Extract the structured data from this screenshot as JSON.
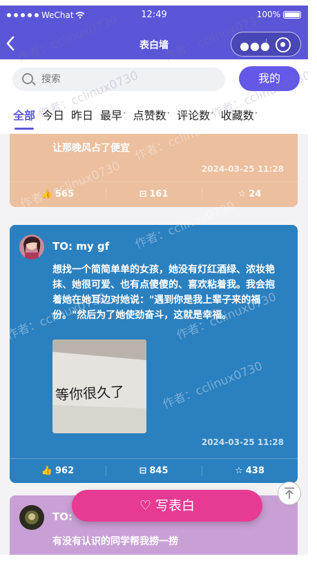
{
  "status_bar": {
    "carrier": "WeChat",
    "time": "12:49",
    "battery": "100%"
  },
  "nav": {
    "title": "表白墙",
    "more_icon": "more-dots-icon",
    "target_icon": "target-icon"
  },
  "search": {
    "placeholder": "搜索",
    "mine_button": "我的"
  },
  "tabs": [
    {
      "label": "全部",
      "active": true
    },
    {
      "label": "今日"
    },
    {
      "label": "昨日"
    },
    {
      "label": "最早"
    },
    {
      "label": "点赞数"
    },
    {
      "label": "评论数"
    },
    {
      "label": "收藏数"
    }
  ],
  "posts": [
    {
      "content": "让那晚风占了便宜",
      "date": "2024-03-25 11:28",
      "likes": "565",
      "comments": "161",
      "favorites": "24",
      "color": "#ecbf9e"
    },
    {
      "to": "TO: my gf",
      "content": "想找一个简简单单的女孩，她没有灯红酒绿、浓妆艳抹、她很可爱、也有点傻傻的、喜欢粘着我。我会抱着她在她耳边对她说：\"遇到你是我上辈子来的福份。\"然后为了她使劲奋斗，这就是幸福。",
      "photo_text": "等你很久了",
      "date": "2024-03-25 11:28",
      "likes": "962",
      "comments": "845",
      "favorites": "438",
      "color": "#2b80bf"
    },
    {
      "to": "TO:",
      "content": "有没有认识的同学帮我捞一捞",
      "color": "#c9a0d6"
    }
  ],
  "post_button": "写表白",
  "watermark": "作者：cclinux0730"
}
